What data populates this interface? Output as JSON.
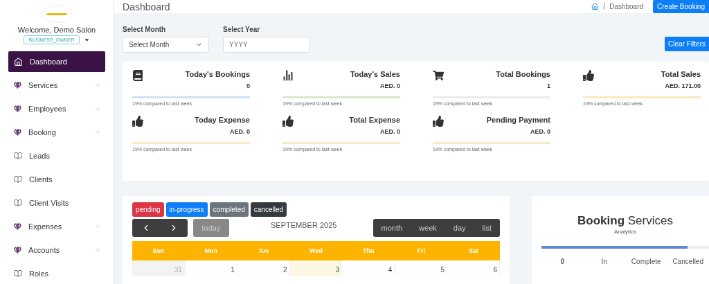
{
  "sidebar": {
    "welcome": "Welcome, Demo Salon",
    "role": "BUSINESS_OWNER",
    "items": [
      {
        "label": "Dashboard",
        "kind": "home",
        "selected": true
      },
      {
        "label": "Services",
        "kind": "group",
        "selected": false
      },
      {
        "label": "Employees",
        "kind": "group",
        "selected": false
      },
      {
        "label": "Booking",
        "kind": "group",
        "selected": false
      },
      {
        "label": "Leads",
        "kind": "link",
        "selected": false
      },
      {
        "label": "Clients",
        "kind": "link",
        "selected": false
      },
      {
        "label": "Client Visits",
        "kind": "link",
        "selected": false
      },
      {
        "label": "Expenses",
        "kind": "group",
        "selected": false
      },
      {
        "label": "Accounts",
        "kind": "group",
        "selected": false
      },
      {
        "label": "Roles",
        "kind": "link",
        "selected": false
      }
    ]
  },
  "header": {
    "title": "Dashboard",
    "breadcrumb": [
      "/",
      "Dashboard"
    ],
    "button": "Create Booking"
  },
  "filters": {
    "month": {
      "label": "Select Month",
      "value": "Select Month"
    },
    "year": {
      "label": "Select Year",
      "placeholder": "YYYY"
    },
    "clear_button": "Clear Filters"
  },
  "stats": [
    {
      "kind": "book",
      "title": "Today's Bookings",
      "value": "0",
      "note": "19% compared to last week",
      "color": "#cfe2f3"
    },
    {
      "kind": "chart",
      "title": "Today's Sales",
      "value": "AED. 0",
      "note": "19% compared to last week",
      "color": "#d9e8c6"
    },
    {
      "kind": "cart",
      "title": "Total Bookings",
      "value": "1",
      "note": "19% compared to last week",
      "color": "#ececec"
    },
    {
      "kind": "thumb",
      "title": "Total Sales",
      "value": "AED. 171.00",
      "note": "19% compared to last week",
      "color": "#fbe8c4"
    },
    {
      "kind": "thumb",
      "title": "Today Expense",
      "value": "AED. 0",
      "note": "19% compared to last week",
      "color": "#fbe8c4"
    },
    {
      "kind": "thumb",
      "title": "Total Expense",
      "value": "AED. 0",
      "note": "19% compared to last week",
      "color": "#fbe8c4"
    },
    {
      "kind": "thumb",
      "title": "Pending Payment",
      "value": "AED. 0",
      "note": "19% compared to last week",
      "color": "#fbe8c4"
    }
  ],
  "calendar": {
    "legend": [
      {
        "label": "pending",
        "color": "#dc3545"
      },
      {
        "label": "in-progress",
        "color": "#0d7ef5"
      },
      {
        "label": "completed",
        "color": "#6c757d"
      },
      {
        "label": "cancelled",
        "color": "#343a40"
      }
    ],
    "today_button": "today",
    "title": "SEPTEMBER 2025",
    "views": [
      {
        "label": "month",
        "selected": false
      },
      {
        "label": "week",
        "selected": false
      },
      {
        "label": "day",
        "selected": false
      },
      {
        "label": "list",
        "selected": false
      }
    ],
    "weekdays": [
      "Sun",
      "Mon",
      "Tue",
      "Wed",
      "Thu",
      "Fri",
      "Sat"
    ],
    "days": [
      {
        "label": "31",
        "other_month": true,
        "today": false
      },
      {
        "label": "1",
        "other_month": false,
        "today": false
      },
      {
        "label": "2",
        "other_month": false,
        "today": false
      },
      {
        "label": "3",
        "other_month": false,
        "today": true
      },
      {
        "label": "4",
        "other_month": false,
        "today": false
      },
      {
        "label": "5",
        "other_month": false,
        "today": false
      },
      {
        "label": "6",
        "other_month": false,
        "today": false
      }
    ]
  },
  "analytics": {
    "title": "**Booking** Services",
    "subtitle": "Analytics",
    "level": 0.87,
    "columns": [
      "0",
      "In",
      "Complete",
      "Cancelled"
    ]
  }
}
